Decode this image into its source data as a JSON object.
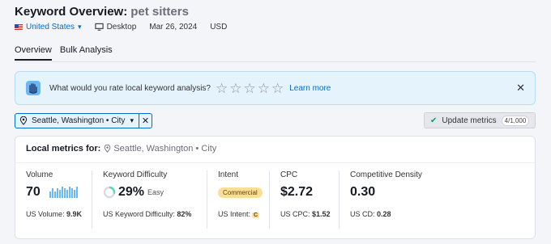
{
  "header": {
    "title": "Keyword Overview:",
    "keyword": "pet sitters"
  },
  "meta": {
    "country": "United States",
    "device": "Desktop",
    "date": "Mar 26, 2024",
    "currency": "USD"
  },
  "tabs": [
    {
      "label": "Overview",
      "active": true
    },
    {
      "label": "Bulk Analysis",
      "active": false
    }
  ],
  "banner": {
    "question": "What would you rate local keyword analysis?",
    "stars_count": 5,
    "learn_more": "Learn more"
  },
  "location_chip": {
    "city": "Seattle, Washington",
    "type": "City"
  },
  "update": {
    "label": "Update metrics",
    "count": "4/1,000"
  },
  "local_metrics": {
    "heading": "Local metrics for:",
    "city": "Seattle, Washington",
    "type": "City"
  },
  "metrics": {
    "volume": {
      "label": "Volume",
      "value": "70",
      "sub_label": "US Volume:",
      "sub_value": "9.9K"
    },
    "kd": {
      "label": "Keyword Difficulty",
      "value": "29%",
      "level": "Easy",
      "sub_label": "US Keyword Difficulty:",
      "sub_value": "82%",
      "percent": 29
    },
    "intent": {
      "label": "Intent",
      "value": "Commercial",
      "sub_label": "US Intent:",
      "sub_value": "C"
    },
    "cpc": {
      "label": "CPC",
      "value": "$2.72",
      "sub_label": "US CPC:",
      "sub_value": "$1.52"
    },
    "density": {
      "label": "Competitive Density",
      "value": "0.30",
      "sub_label": "US CD:",
      "sub_value": "0.28"
    }
  },
  "volume_trend": [
    0.55,
    0.85,
    0.55,
    0.85,
    0.7,
    1.0,
    0.85,
    0.7,
    1.0,
    0.85,
    0.7,
    1.0
  ],
  "colors": {
    "link": "#006dca",
    "banner_bg": "#e5f3fd",
    "intent_badge": "#fcdf96",
    "trend_bar": "#6cb6f2",
    "check": "#00a35c"
  },
  "icons": {
    "flag": "us-flag-icon",
    "device": "desktop-icon",
    "banner": "raised-hand-icon",
    "location": "map-pin-icon",
    "close": "close-icon",
    "check": "checkmark-icon"
  }
}
